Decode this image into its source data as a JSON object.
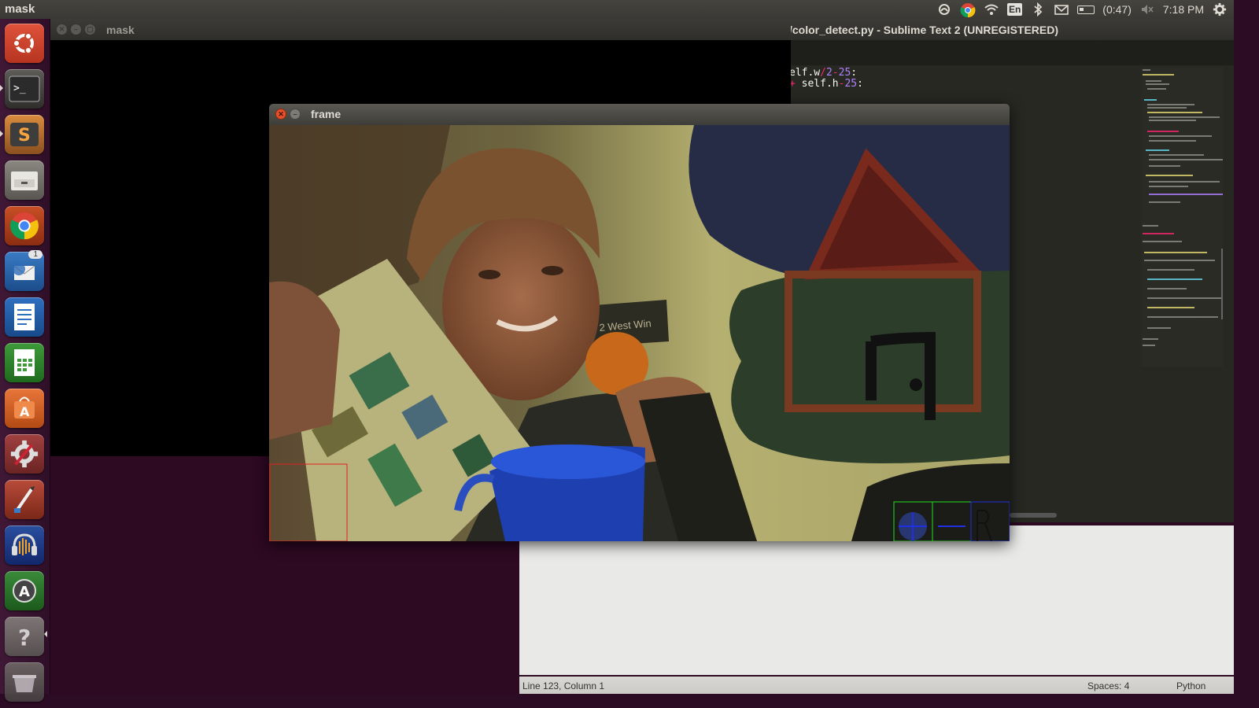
{
  "panel": {
    "app_title": "mask",
    "tray": {
      "language": "En",
      "battery": "(0:47)",
      "clock": "7:18 PM"
    }
  },
  "launcher": {
    "items": [
      {
        "name": "ubuntu-dash-icon"
      },
      {
        "name": "terminal-icon"
      },
      {
        "name": "sublime-text-icon"
      },
      {
        "name": "file-manager-icon"
      },
      {
        "name": "chrome-icon"
      },
      {
        "name": "thunderbird-icon",
        "badge": "1"
      },
      {
        "name": "writer-icon"
      },
      {
        "name": "calc-icon"
      },
      {
        "name": "software-center-icon"
      },
      {
        "name": "system-settings-icon"
      },
      {
        "name": "paint-icon"
      },
      {
        "name": "audacity-icon"
      },
      {
        "name": "update-manager-icon"
      },
      {
        "name": "help-icon"
      },
      {
        "name": "trash-icon"
      }
    ]
  },
  "mask_window": {
    "title": "mask"
  },
  "frame_window": {
    "title": "frame"
  },
  "sublime": {
    "title": "/color_detect.py - Sublime Text 2 (UNREGISTERED)",
    "code_lines": [
      {
        "a": "elf.w",
        "op": "/",
        "n1": "2",
        "op2": "-",
        "n2": "25",
        "tail": ":"
      },
      {
        "a": "self.h",
        "op": "-",
        "n1": "25",
        "tail": ":"
      }
    ],
    "status": {
      "position": "Line 123, Column 1",
      "spaces": "Spaces: 4",
      "syntax": "Python"
    }
  },
  "colors": {
    "launcher_bg": "#3f1836",
    "desktop_bg": "#2d0922",
    "sublime_bg": "#272822",
    "close_button": "#e6512b"
  }
}
